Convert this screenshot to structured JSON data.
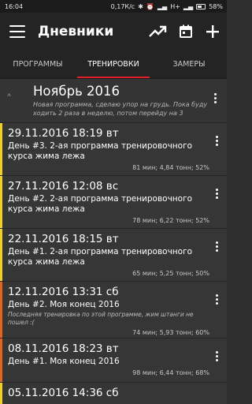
{
  "status": {
    "time": "16:04",
    "speed": "0,17К/с",
    "network": "H+",
    "battery": "58%"
  },
  "appbar": {
    "title": "Дневники"
  },
  "tabs": [
    {
      "label": "ПРОГРАММЫ",
      "active": false
    },
    {
      "label": "ТРЕНИРОВКИ",
      "active": true
    },
    {
      "label": "ЗАМЕРЫ",
      "active": false
    }
  ],
  "section": {
    "month": "Ноябрь 2016",
    "note": "Новая программа, сделаю упор на грудь. Пока буду ходить 2 раза в неделю, потом перейду на 3"
  },
  "workouts": [
    {
      "date": "29.11.2016 18:19 вт",
      "name": "День #3. 2-ая программа тренировочного курса жима лежа",
      "comment": "",
      "stats": "81 мин; 4,84 тонн; 52%",
      "color": "#f0d020"
    },
    {
      "date": "27.11.2016 12:08 вс",
      "name": "День #2. 2-ая программа тренировочного курса жима лежа",
      "comment": "",
      "stats": "78 мин; 6,22 тонн; 52%",
      "color": "#f0d020"
    },
    {
      "date": "22.11.2016 18:15 вт",
      "name": "День #1. 2-ая программа тренировочного курса жима лежа",
      "comment": "",
      "stats": "65 мин; 5,25 тонн; 50%",
      "color": "#f0d020"
    },
    {
      "date": "12.11.2016 13:31 сб",
      "name": "День #2. Моя конец 2016",
      "comment": "Последняя тренировка по этой программе, жим штанги не пошел :(",
      "stats": "74 мин; 5,93 тонн; 60%",
      "color": "#e8641e"
    },
    {
      "date": "08.11.2016 18:23 вт",
      "name": "День #1. Моя конец 2016",
      "comment": "",
      "stats": "98 мин; 6,44 тонн; 68%",
      "color": "#e8641e"
    },
    {
      "date": "05.11.2016 14:36 сб",
      "name": "",
      "comment": "",
      "stats": "",
      "color": "#f0d020"
    }
  ],
  "colors": {
    "accent": "#e0202a",
    "yellow": "#f0d020",
    "orange": "#e8641e"
  }
}
